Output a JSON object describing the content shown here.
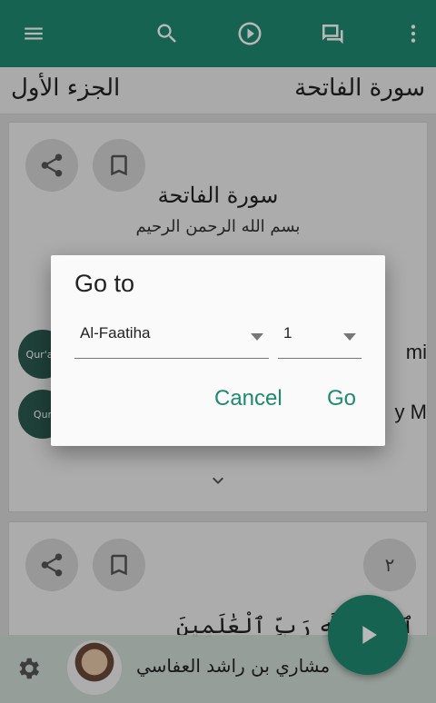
{
  "colors": {
    "primary": "#1e8a70",
    "background": "#d9d9d9",
    "card": "#efefef"
  },
  "appbar": {
    "icons": [
      "menu-icon",
      "search-icon",
      "play-circle-icon",
      "chat-bubbles-icon",
      "more-vert-icon"
    ]
  },
  "header": {
    "juz_label": "الجزء الأول",
    "sura_label": "سورة الفاتحة"
  },
  "card1": {
    "sura_title": "سورة الفاتحة",
    "basmala": "بسم الله الرحمن الرحيم",
    "reciter_rows": [
      {
        "logo_text": "Qur'an",
        "name": "mi"
      },
      {
        "logo_text": "Qur",
        "name": "y M"
      }
    ]
  },
  "card2": {
    "ayah_number": "٢",
    "ayah_text": "ٱلْحَمْدُ لِلَّهِ رَبِّ ٱلْعَٰلَمِينَ"
  },
  "player": {
    "reciter_name": "مشاري بن راشد العفاسي"
  },
  "dialog": {
    "title": "Go to",
    "sura_select": "Al-Faatiha",
    "ayah_select": "1",
    "cancel_label": "Cancel",
    "go_label": "Go"
  }
}
